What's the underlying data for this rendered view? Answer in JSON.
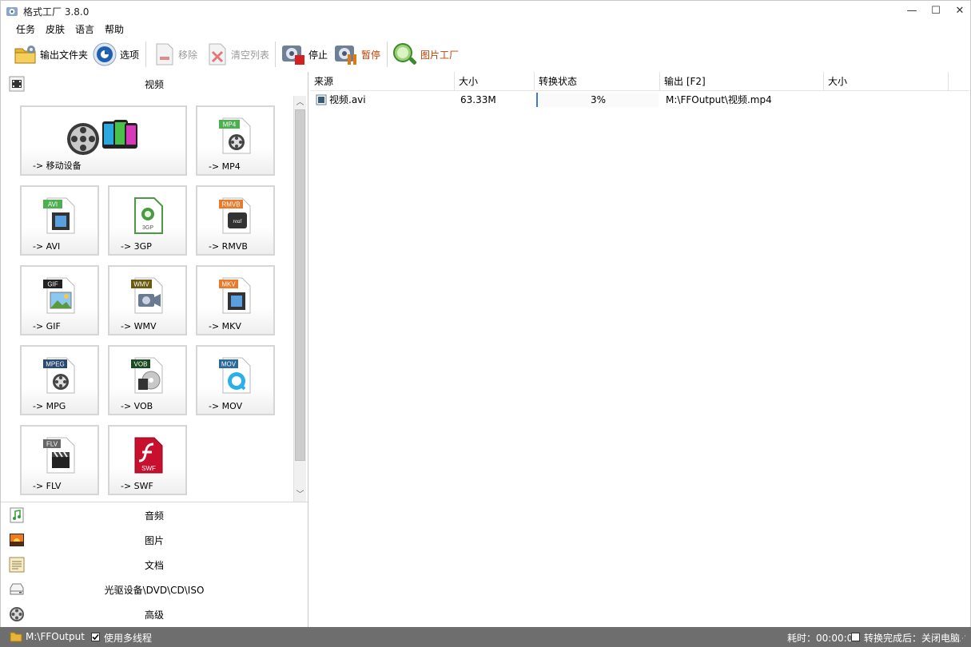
{
  "window": {
    "title": "格式工厂 3.8.0"
  },
  "menu": [
    {
      "label": "任务"
    },
    {
      "label": "皮肤"
    },
    {
      "label": "语言"
    },
    {
      "label": "帮助"
    }
  ],
  "toolbar": {
    "output_folder": "输出文件夹",
    "options": "选项",
    "remove": "移除",
    "clear_list": "清空列表",
    "stop": "停止",
    "pause": "暂停",
    "picture_factory": "图片工厂"
  },
  "categories": {
    "video": "视频",
    "audio": "音频",
    "picture": "图片",
    "document": "文档",
    "rom": "光驱设备\\DVD\\CD\\ISO",
    "advanced": "高级"
  },
  "tiles": {
    "mobile": {
      "label": "-> 移动设备"
    },
    "mp4": {
      "label": "-> MP4",
      "tag": "MP4"
    },
    "avi": {
      "label": "-> AVI",
      "tag": "AVI"
    },
    "3gp": {
      "label": "-> 3GP",
      "tag": "3GP"
    },
    "rmvb": {
      "label": "-> RMVB",
      "tag": "RMVB"
    },
    "gif": {
      "label": "-> GIF",
      "tag": "GIF"
    },
    "wmv": {
      "label": "-> WMV",
      "tag": "WMV"
    },
    "mkv": {
      "label": "-> MKV",
      "tag": "MKV"
    },
    "mpg": {
      "label": "-> MPG",
      "tag": "MPEG"
    },
    "vob": {
      "label": "-> VOB",
      "tag": "VOB"
    },
    "mov": {
      "label": "-> MOV",
      "tag": "MOV"
    },
    "flv": {
      "label": "-> FLV",
      "tag": "FLV"
    },
    "swf": {
      "label": "-> SWF",
      "tag": "SWF"
    }
  },
  "table": {
    "headers": {
      "source": "来源",
      "size": "大小",
      "status": "转换状态",
      "output": "输出 [F2]",
      "output_size": "大小"
    },
    "rows": [
      {
        "source": "视频.avi",
        "size": "63.33M",
        "status": "3%",
        "progress": 0.03,
        "output": "M:\\FFOutput\\视频.mp4",
        "output_size": ""
      }
    ]
  },
  "statusbar": {
    "output_path": "M:\\FFOutput",
    "multithread": "使用多线程",
    "multithread_checked": true,
    "elapsed": "耗时：00:00:04",
    "after_done": "转换完成后：关闭电脑",
    "after_done_checked": false
  },
  "colors": {
    "statusbar_bg": "#6e6e6e",
    "progress_accent": "#3a7bd5",
    "pause_label": "#c04000",
    "picture_factory_label": "#c04000"
  }
}
